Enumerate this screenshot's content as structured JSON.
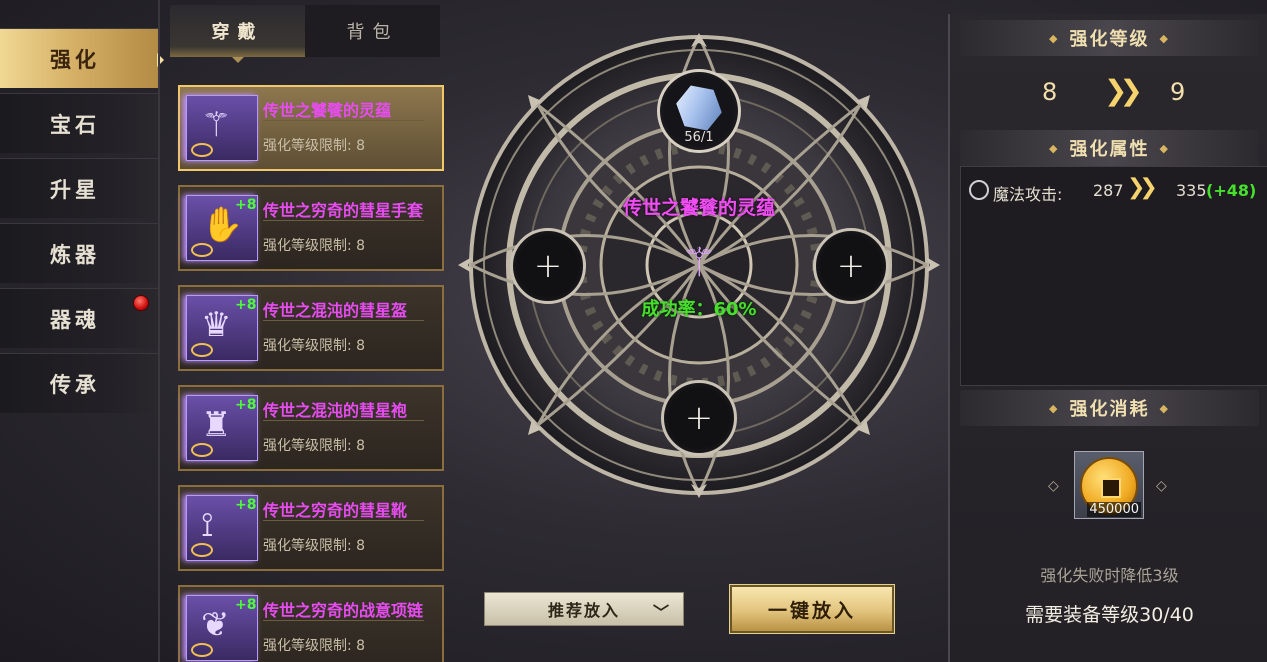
{
  "side_tabs": [
    {
      "label": "强化",
      "active": true
    },
    {
      "label": "宝石"
    },
    {
      "label": "升星"
    },
    {
      "label": "炼器"
    },
    {
      "label": "器魂",
      "notification": true
    },
    {
      "label": "传承"
    }
  ],
  "list_tabs": {
    "worn": "穿戴",
    "bag": "背包"
  },
  "equipment": [
    {
      "name": "传世之饕餮的灵蕴",
      "plus": "",
      "limit": "强化等级限制: 8",
      "icon": "staff-icon",
      "selected": true
    },
    {
      "name": "传世之穷奇的彗星手套",
      "plus": "+8",
      "limit": "强化等级限制: 8",
      "icon": "gloves-icon"
    },
    {
      "name": "传世之混沌的彗星盔",
      "plus": "+8",
      "limit": "强化等级限制: 8",
      "icon": "helmet-icon"
    },
    {
      "name": "传世之混沌的彗星袍",
      "plus": "+8",
      "limit": "强化等级限制: 8",
      "icon": "robe-icon"
    },
    {
      "name": "传世之穷奇的彗星靴",
      "plus": "+8",
      "limit": "强化等级限制: 8",
      "icon": "boots-icon"
    },
    {
      "name": "传世之穷奇的战意项链",
      "plus": "+8",
      "limit": "强化等级限制: 8",
      "icon": "necklace-icon"
    }
  ],
  "center": {
    "gem_count": "56/1",
    "item_name": "传世之饕餮的灵蕴",
    "success_rate": "成功率：60%",
    "plus_symbol": "+"
  },
  "buttons": {
    "recommend": "推荐放入",
    "one_key": "一键放入"
  },
  "right": {
    "level_header": "强化等级",
    "level_from": "8",
    "level_to": "9",
    "attr_header": "强化属性",
    "attr_name": "魔法攻击:",
    "attr_from": "287",
    "attr_to": "335",
    "attr_delta": "(+48)",
    "cost_header": "强化消耗",
    "cost_qty": "450000",
    "fail_note": "强化失败时降低3级",
    "require_note": "需要装备等级30/40"
  },
  "colors": {
    "accent_gold": "#d6b167",
    "item_name_purple": "#e64cf0",
    "success_green": "#46e02c",
    "notification_red": "#d01010"
  }
}
